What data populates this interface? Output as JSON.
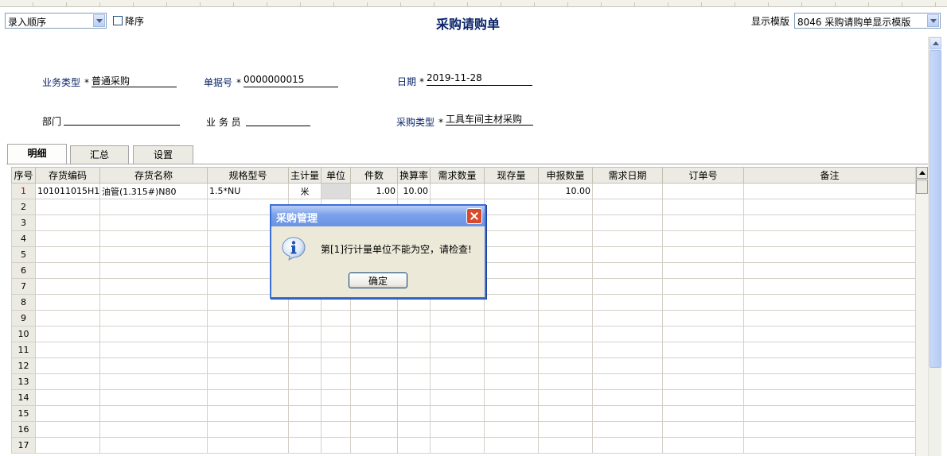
{
  "toolbar": {
    "visible": true
  },
  "sort": {
    "value": "录入顺序",
    "descending_label": "降序"
  },
  "page_title": "采购请购单",
  "template": {
    "label": "显示模版",
    "value": "8046 采购请购单显示模版"
  },
  "header": {
    "business_type": {
      "label": "业务类型",
      "value": "普通采购"
    },
    "doc_no": {
      "label": "单据号",
      "value": "0000000015"
    },
    "date": {
      "label": "日期",
      "value": "2019-11-28"
    },
    "department": {
      "label": "部门",
      "value": ""
    },
    "salesman": {
      "label": "业 务 员",
      "value": ""
    },
    "purchase_type": {
      "label": "采购类型",
      "value": "工具车间主材采购"
    },
    "required_mark": "*"
  },
  "tabs": [
    {
      "label": "明细"
    },
    {
      "label": "汇总"
    },
    {
      "label": "设置"
    }
  ],
  "grid": {
    "columns": [
      "序号",
      "存货编码",
      "存货名称",
      "规格型号",
      "主计量",
      "单位",
      "件数",
      "换算率",
      "需求数量",
      "现存量",
      "申报数量",
      "需求日期",
      "订单号",
      "备注"
    ],
    "rows": [
      [
        "1",
        "101011015H1",
        "油管(1.315#)N80",
        "1.5*NU",
        "米",
        "",
        "1.00",
        "10.00",
        "",
        "",
        "10.00",
        "",
        "",
        ""
      ]
    ],
    "row_numbers": [
      "1",
      "2",
      "3",
      "4",
      "5",
      "6",
      "7",
      "8",
      "9",
      "10",
      "11",
      "12",
      "13",
      "14",
      "15",
      "16",
      "17"
    ]
  },
  "dialog": {
    "title": "采购管理",
    "message": "第[1]行计量单位不能为空，请检查!",
    "ok_label": "确定"
  },
  "colors": {
    "title_blue": "#0a246a",
    "dialog_border": "#3c6fd6",
    "current_row_red": "#c00000"
  }
}
